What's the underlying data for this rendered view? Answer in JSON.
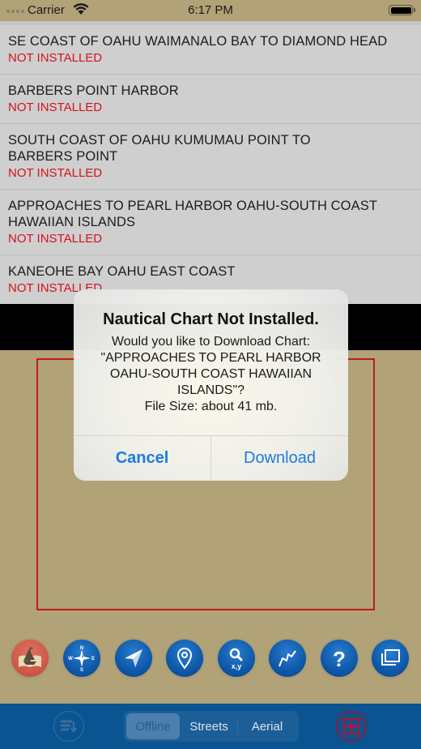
{
  "status_bar": {
    "carrier": "Carrier",
    "time": "6:17 PM"
  },
  "charts": [
    {
      "title": "SE COAST OF OAHU  WAIMANALO BAY TO DIAMOND HEAD",
      "status": "NOT INSTALLED"
    },
    {
      "title": "BARBERS POINT HARBOR",
      "status": "NOT INSTALLED"
    },
    {
      "title": "SOUTH COAST OF OAHU KUMUMAU POINT TO BARBERS POINT",
      "status": "NOT INSTALLED"
    },
    {
      "title": "APPROACHES TO PEARL HARBOR  OAHU-SOUTH COAST HAWAIIAN ISLANDS",
      "status": "NOT INSTALLED"
    },
    {
      "title": "KANEOHE BAY  OAHU EAST COAST",
      "status": "NOT INSTALLED"
    }
  ],
  "toolbar": {
    "buttons": [
      {
        "name": "charts",
        "icon": "sailboat-book-icon"
      },
      {
        "name": "compass",
        "icon": "compass-icon",
        "labels": [
          "N",
          "S",
          "W",
          "E"
        ]
      },
      {
        "name": "navigate",
        "icon": "location-arrow-icon"
      },
      {
        "name": "pin",
        "icon": "map-pin-icon"
      },
      {
        "name": "coordinates-search",
        "icon": "search-xy-icon",
        "label": "x,y"
      },
      {
        "name": "route",
        "icon": "route-icon"
      },
      {
        "name": "help",
        "icon": "help-icon",
        "label": "?"
      },
      {
        "name": "layers",
        "icon": "layers-icon"
      }
    ]
  },
  "bottom_bar": {
    "segments": [
      "Offline",
      "Streets",
      "Aerial"
    ],
    "selected": "Offline",
    "left_icon": "list-download-icon",
    "right_icon": "chart-bounds-icon"
  },
  "alert": {
    "title": "Nautical Chart Not Installed.",
    "message_lines": [
      "Would you like to Download Chart:",
      "\"APPROACHES TO PEARL HARBOR",
      "OAHU-SOUTH COAST  HAWAIIAN",
      "ISLANDS\"?",
      "File Size: about 41 mb."
    ],
    "cancel_label": "Cancel",
    "confirm_label": "Download"
  },
  "colors": {
    "map_background": "#b1a277",
    "not_installed": "#d4121c",
    "chart_bounds": "#c21a14",
    "bottom_bar": "#0a5491",
    "alert_button": "#1c7ce0"
  }
}
